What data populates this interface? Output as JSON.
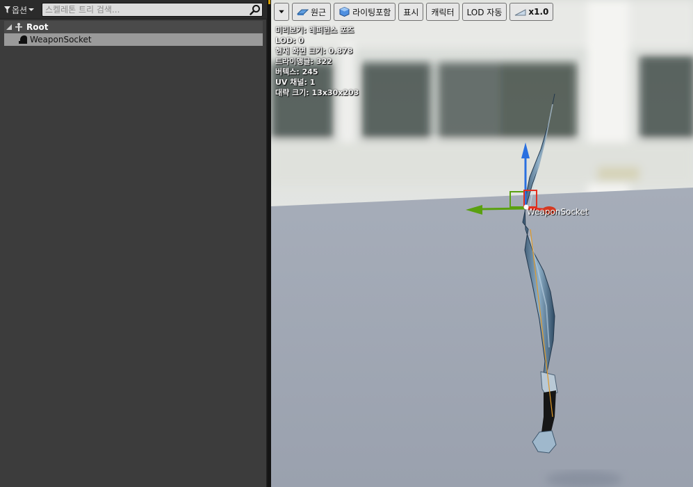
{
  "left_panel": {
    "options_label": "옵션",
    "search_placeholder": "스켈레톤 트리 검색...",
    "tree": {
      "root_label": "Root",
      "socket_label": "WeaponSocket"
    }
  },
  "viewport": {
    "toolbar": {
      "perspective_label": "원근",
      "lighting_label": "라이팅포함",
      "show_label": "표시",
      "character_label": "캐릭터",
      "lod_label": "LOD 자동",
      "speed_label": "x1.0"
    },
    "stats": [
      "미리보기: 레퍼런스 포즈",
      "LOD: 0",
      "현재 화면 크기: 0.878",
      "트라이앵글: 322",
      "버텍스: 245",
      "UV 채널: 1",
      "대략 크기: 13x30x203"
    ],
    "socket_label": "WeaponSocket"
  },
  "colors": {
    "panel_bg": "#3c3c3c",
    "selected_row": "#9a9a9a",
    "accent": "#d9a000",
    "gizmo_x": "#e03020",
    "gizmo_y": "#5aa010",
    "gizmo_z": "#2a70e0"
  },
  "icons": {
    "filter": "funnel-icon",
    "search": "magnifier-icon",
    "root": "bone-icon",
    "socket": "socket-icon"
  }
}
